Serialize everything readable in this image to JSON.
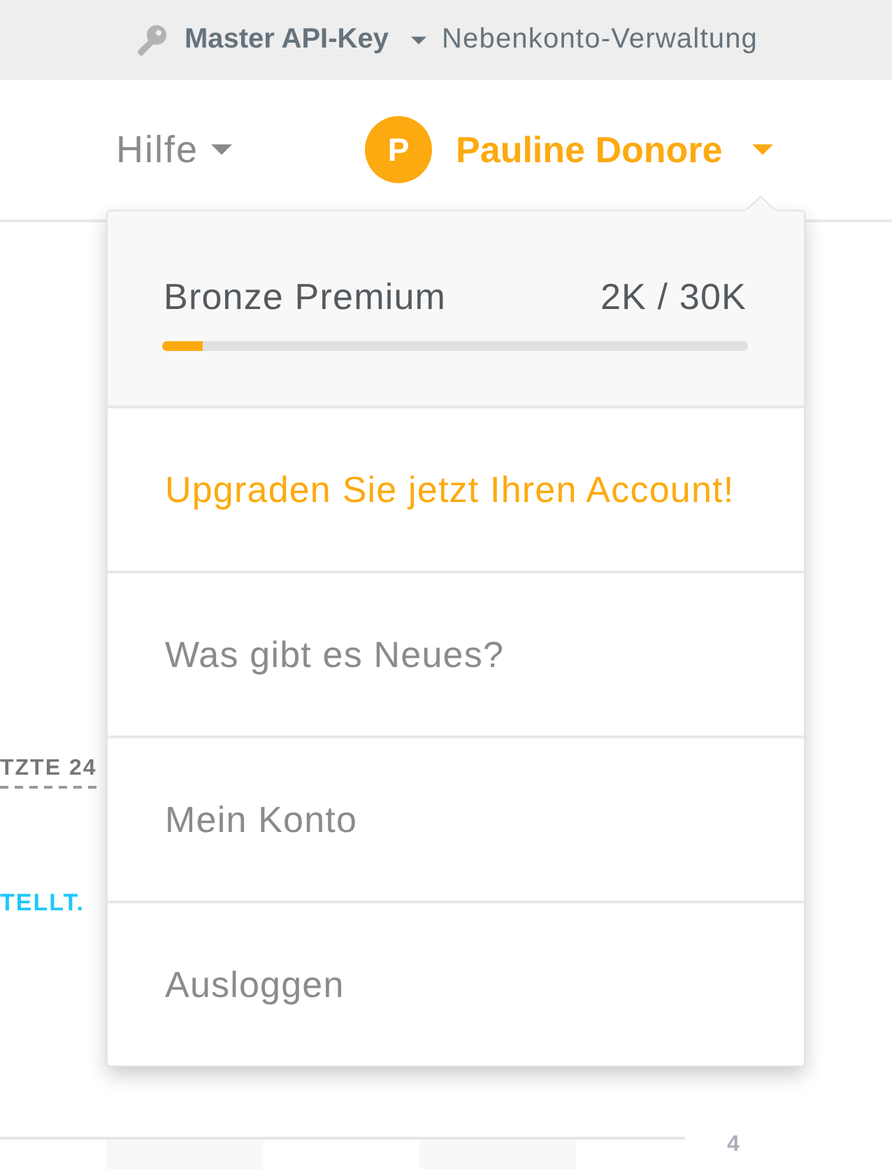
{
  "top_bar": {
    "api_key_label": "Master API-Key",
    "subaccount_link": "Nebenkonto-Verwaltung"
  },
  "header": {
    "help_menu": "Hilfe",
    "user": {
      "initial": "P",
      "name": "Pauline Donore"
    }
  },
  "background": {
    "period_label": "TZTE 24",
    "status_text": "TELLT.",
    "page_number": "4"
  },
  "account_menu": {
    "plan": {
      "name": "Bronze Premium",
      "usage": "2K / 30K",
      "level": 0.07
    },
    "items": [
      {
        "label": "Upgraden Sie jetzt Ihren Account!",
        "kind": "highlight"
      },
      {
        "label": "Was gibt es Neues?",
        "kind": "plain"
      },
      {
        "label": "Mein Konto",
        "kind": "plain"
      },
      {
        "label": "Ausloggen",
        "kind": "plain"
      }
    ]
  }
}
